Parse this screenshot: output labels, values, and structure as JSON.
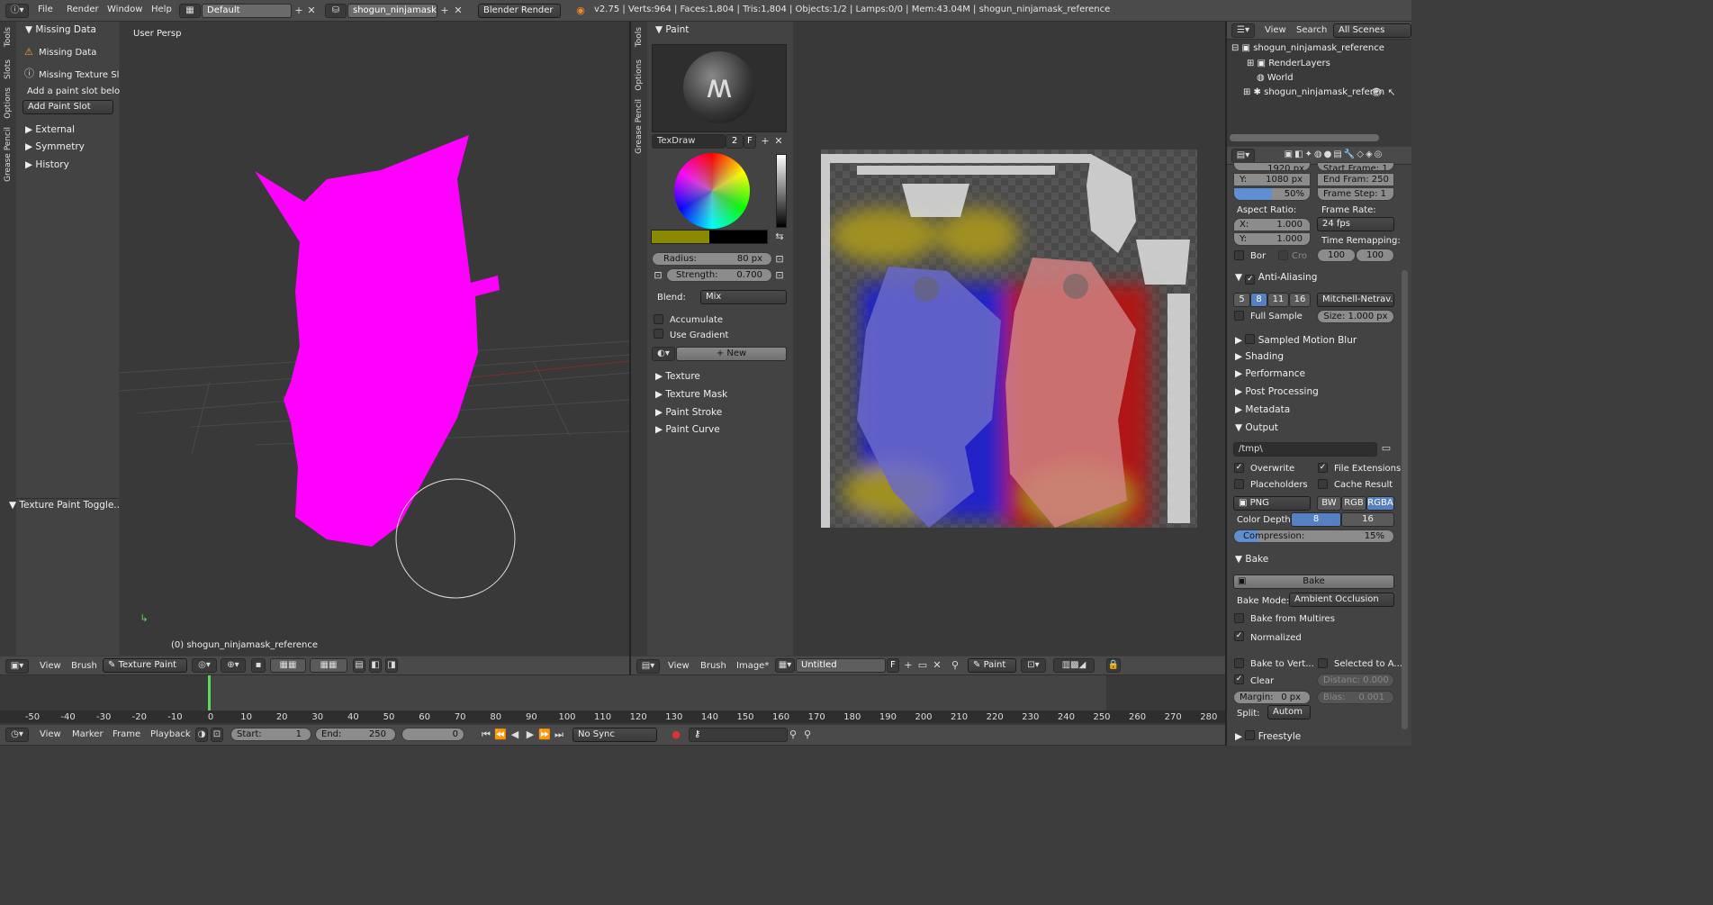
{
  "topbar": {
    "menus": [
      "File",
      "Render",
      "Window",
      "Help"
    ],
    "layout": "Default",
    "scene": "shogun_ninjamask_r...",
    "engine": "Blender Render",
    "stats": "v2.75 | Verts:964 | Faces:1,804 | Tris:1,804 | Objects:1/2 | Lamps:0/0 | Mem:43.04M | shogun_ninjamask_reference"
  },
  "left_toolshelf": {
    "tabs": [
      "Tools",
      "Slots",
      "Options",
      "Grease Pencil"
    ],
    "missing_header": "Missing Data",
    "warn": "Missing Data",
    "missing_slot": "Missing Texture Sl...",
    "hint": "Add a paint slot below",
    "add_slot": "Add Paint Slot",
    "panels": [
      "External",
      "Symmetry",
      "History"
    ],
    "toggle_panel": "Texture Paint Toggle..."
  },
  "viewport3d": {
    "label": "User Persp",
    "object_label": "(0) shogun_ninjamask_reference",
    "header": {
      "view": "View",
      "brush": "Brush",
      "mode": "Texture Paint"
    }
  },
  "paint_panel": {
    "tabs": [
      "Tools",
      "Options",
      "Grease Pencil"
    ],
    "header": "Paint",
    "brush_name": "TexDraw",
    "brush_users": "2",
    "brush_fake": "F",
    "radius_label": "Radius:",
    "radius_value": "80 px",
    "strength_label": "Strength:",
    "strength_value": "0.700",
    "blend_label": "Blend:",
    "blend_value": "Mix",
    "accumulate": "Accumulate",
    "use_gradient": "Use Gradient",
    "new_label": "New",
    "subpanels": [
      "Texture",
      "Texture Mask",
      "Paint Stroke",
      "Paint Curve"
    ],
    "color": "#8a8a00"
  },
  "image_editor": {
    "header": {
      "view": "View",
      "brush": "Brush",
      "image": "Image*",
      "image_name": "Untitled",
      "fake": "F",
      "mode": "Paint"
    }
  },
  "outliner": {
    "header": {
      "view": "View",
      "search": "Search",
      "scenes": "All Scenes"
    },
    "items": [
      "shogun_ninjamask_reference",
      "RenderLayers",
      "World",
      "shogun_ninjamask_referen"
    ]
  },
  "properties": {
    "res_x": "1920 px",
    "res_y_label": "Y:",
    "res_y": "1080 px",
    "res_pct": "50%",
    "start_frame": "Start Frame: 1",
    "end_frame": "End Fram: 250",
    "frame_step": "Frame Step: 1",
    "aspect_label": "Aspect Ratio:",
    "aspect_x_label": "X:",
    "aspect_x": "1.000",
    "aspect_y_label": "Y:",
    "aspect_y": "1.000",
    "frame_rate_label": "Frame Rate:",
    "frame_rate": "24 fps",
    "time_remap_label": "Time Remapping:",
    "time_old": "100",
    "time_new": "100",
    "border": "Bor",
    "crop": "Cro",
    "aa_header": "Anti-Aliasing",
    "aa_samples": [
      "5",
      "8",
      "11",
      "16"
    ],
    "aa_filter": "Mitchell-Netrav...",
    "full_sample": "Full Sample",
    "aa_size": "Size: 1.000 px",
    "panels1": [
      "Sampled Motion Blur",
      "Shading",
      "Performance",
      "Post Processing",
      "Metadata"
    ],
    "output_header": "Output",
    "output_path": "/tmp\\",
    "overwrite": "Overwrite",
    "file_ext": "File Extensions",
    "placeholders": "Placeholders",
    "cache_result": "Cache Result",
    "format": "PNG",
    "color_modes": [
      "BW",
      "RGB",
      "RGBA"
    ],
    "color_depth_label": "Color Depth:",
    "depth_8": "8",
    "depth_16": "16",
    "compression_label": "Compression:",
    "compression_value": "15%",
    "bake_header": "Bake",
    "bake_btn": "Bake",
    "bake_mode_label": "Bake Mode:",
    "bake_mode": "Ambient Occlusion",
    "bake_multires": "Bake from Multires",
    "normalized": "Normalized",
    "bake_vert": "Bake to Vert...",
    "selected_to": "Selected to A...",
    "clear": "Clear",
    "distance": "Distanc: 0.000",
    "margin": "Margin:",
    "margin_val": "0 px",
    "bias": "Bias:",
    "bias_val": "0.001",
    "split_label": "Split:",
    "split_val": "Autom",
    "freestyle": "Freestyle"
  },
  "timeline": {
    "ticks": [
      "-50",
      "-40",
      "-30",
      "-20",
      "-10",
      "0",
      "10",
      "20",
      "30",
      "40",
      "50",
      "60",
      "70",
      "80",
      "90",
      "100",
      "110",
      "120",
      "130",
      "140",
      "150",
      "160",
      "170",
      "180",
      "190",
      "200",
      "210",
      "220",
      "230",
      "240",
      "250",
      "260",
      "270",
      "280"
    ],
    "menus": [
      "View",
      "Marker",
      "Frame",
      "Playback"
    ],
    "start_label": "Start:",
    "start": "1",
    "end_label": "End:",
    "end": "250",
    "current": "0",
    "sync": "No Sync"
  }
}
